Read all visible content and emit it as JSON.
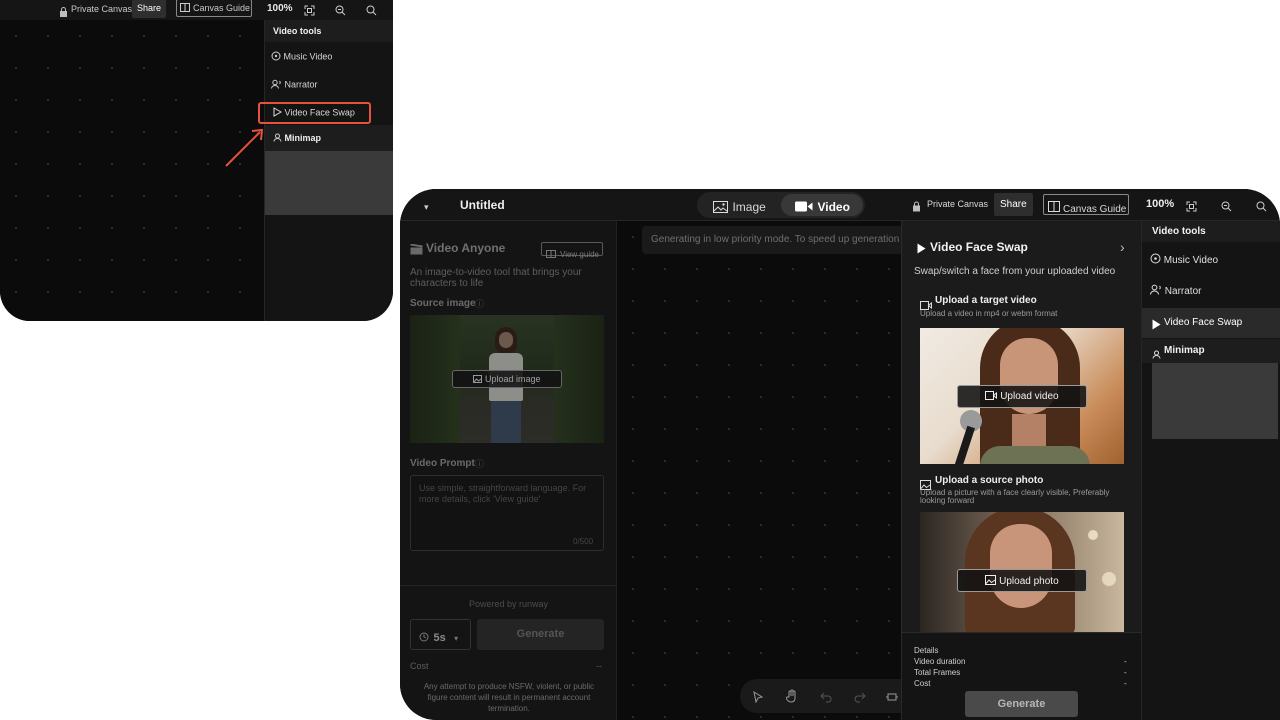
{
  "inset": {
    "topbar": {
      "private_canvas": "Private Canvas",
      "share": "Share",
      "canvas_guide": "Canvas Guide",
      "zoom": "100%"
    },
    "sidebar": {
      "header": "Video tools",
      "items": [
        {
          "label": "Music Video",
          "icon": "music-disc-icon"
        },
        {
          "label": "Narrator",
          "icon": "narrator-icon"
        },
        {
          "label": "Video Face Swap",
          "icon": "play-icon"
        }
      ],
      "minimap": "Minimap"
    },
    "highlight_color": "#e5533c"
  },
  "main": {
    "topbar": {
      "title": "Untitled",
      "tabs": [
        {
          "label": "Image",
          "icon": "image-icon",
          "active": false
        },
        {
          "label": "Video",
          "icon": "video-camera-icon",
          "active": true
        }
      ],
      "private_canvas": "Private Canvas",
      "share": "Share",
      "canvas_guide": "Canvas Guide",
      "zoom": "100%"
    },
    "left_panel": {
      "title": "Video Anyone",
      "view_guide": "View guide",
      "description": "An image-to-video tool that brings your characters to life",
      "source_image_label": "Source image",
      "upload_image": "Upload image",
      "video_prompt_label": "Video Prompt",
      "prompt_placeholder": "Use simple, straightforward language. For more details, click 'View guide'",
      "prompt_counter": "0/500",
      "powered_by": "Powered by runway",
      "duration": "5s",
      "generate": "Generate",
      "cost_label": "Cost",
      "cost_value": "--",
      "disclaimer": "Any attempt to produce NSFW, violent, or public figure content will result in permanent account termination."
    },
    "center": {
      "notice": "Generating in low priority mode. To speed up generation"
    },
    "face_swap": {
      "title": "Video Face Swap",
      "subtitle": "Swap/switch a face from your uploaded video",
      "target_title": "Upload a target video",
      "target_desc": "Upload a video in mp4 or webm format",
      "upload_video": "Upload video",
      "source_title": "Upload a source photo",
      "source_desc": "Upload a picture with a face clearly visible, Preferably looking forward",
      "upload_photo": "Upload photo",
      "details_label": "Details",
      "details": [
        {
          "label": "Video duration",
          "value": "-"
        },
        {
          "label": "Total Frames",
          "value": "-"
        },
        {
          "label": "Cost",
          "value": "-"
        }
      ],
      "generate": "Generate"
    },
    "right_sidebar": {
      "header": "Video tools",
      "items": [
        {
          "label": "Music Video",
          "icon": "music-disc-icon"
        },
        {
          "label": "Narrator",
          "icon": "narrator-icon"
        },
        {
          "label": "Video Face Swap",
          "icon": "play-icon",
          "active": true
        }
      ],
      "minimap": "Minimap"
    }
  }
}
